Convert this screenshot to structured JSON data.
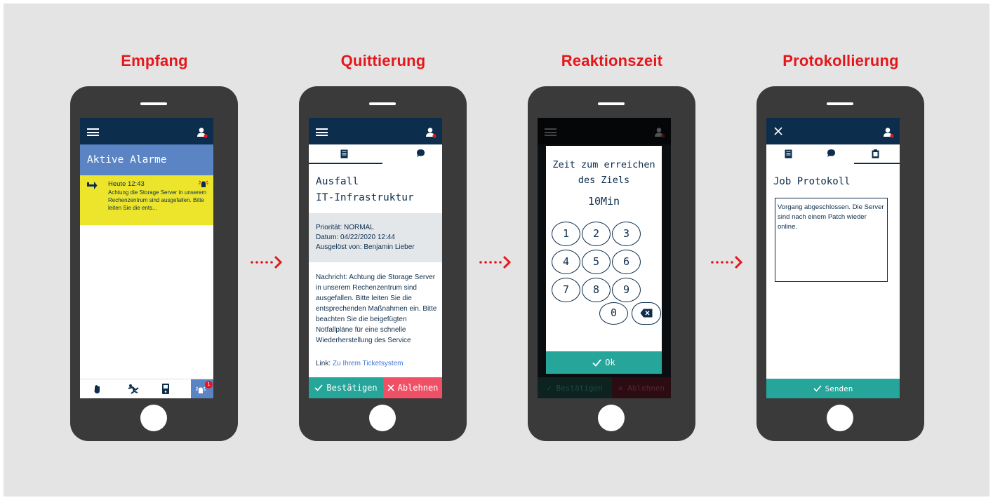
{
  "steps": [
    {
      "title": "Empfang"
    },
    {
      "title": "Quittierung"
    },
    {
      "title": "Reaktionszeit"
    },
    {
      "title": "Protokollierung"
    }
  ],
  "phone1": {
    "heading": "Aktive Alarme",
    "alarm": {
      "time": "Heute 12:43",
      "text": "Achtung die Storage Server in unserem Rechenzentrum sind ausgefallen. Bitte leiten Sie die ents..."
    },
    "nav": [
      {
        "icon": "hand-icon"
      },
      {
        "icon": "falling-person-icon"
      },
      {
        "icon": "device-icon"
      },
      {
        "icon": "alarm-bell-icon",
        "badge": "1"
      }
    ]
  },
  "phone2": {
    "title_line1": "Ausfall",
    "title_line2": "IT-Infrastruktur",
    "prioritaet": "Priorität: NORMAL",
    "datum": "Datum: 04/22/2020 12:44",
    "ausgeloest": "Ausgelöst von: Benjamin Lieber",
    "nachricht": "Nachricht: Achtung die Storage Server in unserem Rechenzentrum sind ausgefallen. Bitte leiten Sie die entsprechenden Maßnahmen ein. Bitte beachten Sie die beigefügten Notfallpläne für eine schnelle Wiederherstellung des Service",
    "link_label": "Link:",
    "link_text": "Zu Ihrem Ticketsystem",
    "confirm": "Bestätigen",
    "reject": "Ablehnen"
  },
  "phone3": {
    "line1": "Zeit zum erreichen",
    "line2": "des Ziels",
    "value": "10Min",
    "keys": [
      "1",
      "2",
      "3",
      "4",
      "5",
      "6",
      "7",
      "8",
      "9",
      "0"
    ],
    "ok": "Ok",
    "confirm": "Bestätigen",
    "reject": "Ablehnen"
  },
  "phone4": {
    "heading": "Job Protokoll",
    "text": "Vorgang abgeschlossen. Die Server sind nach einem Patch wieder online.",
    "send": "Senden"
  },
  "colors": {
    "accent_red": "#e5171b",
    "navy": "#0d2d4d",
    "teal": "#26a69a",
    "pink": "#ef5066",
    "alarm_yellow": "#ede52c",
    "header_blue": "#5b84c4"
  }
}
